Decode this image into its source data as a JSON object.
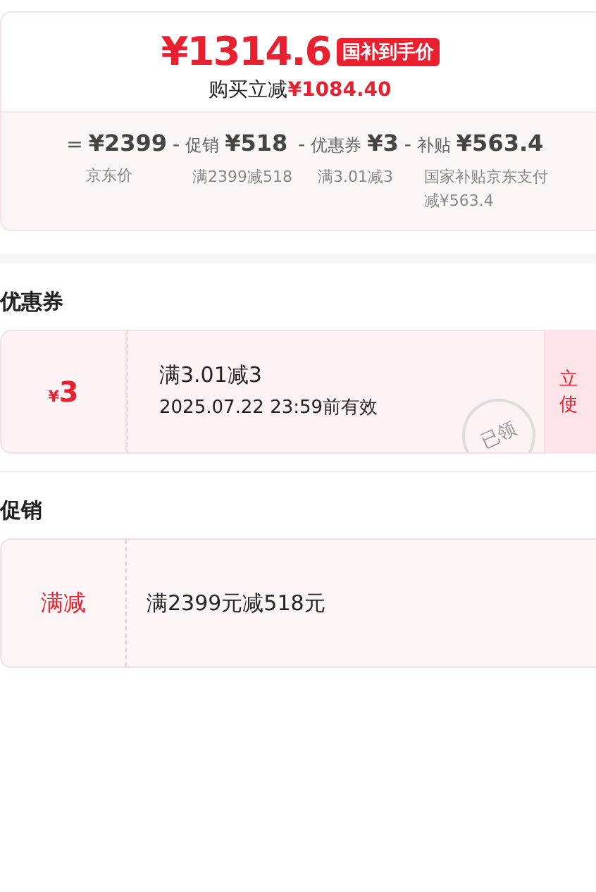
{
  "price": {
    "amount": "¥1314.6",
    "badge": "国补到手价",
    "saving_label": "购买立减",
    "saving_amount": "¥1084.40"
  },
  "breakdown": [
    {
      "operator": "=",
      "amount": "¥2399",
      "note": "京东价"
    },
    {
      "operator": "-",
      "label": "促销",
      "amount": "¥518",
      "note": "满2399减518"
    },
    {
      "operator": "-",
      "label": "优惠券",
      "amount": "¥3",
      "note": "满3.01减3"
    },
    {
      "operator": "-",
      "label": "补贴",
      "amount": "¥563.4",
      "note": "国家补贴京东支付减¥563.4"
    }
  ],
  "coupon_section": {
    "title": "优惠券",
    "coupons": [
      {
        "currency": "¥",
        "amount": "3",
        "condition": "满3.01减3",
        "validity": "2025.07.22 23:59前有效",
        "claimed": true,
        "stamp": "已领",
        "action": [
          "立",
          "使"
        ]
      }
    ]
  },
  "promotion_section": {
    "title": "促销",
    "promotions": [
      {
        "tag": "满减",
        "description": "满2399元减518元"
      }
    ]
  }
}
